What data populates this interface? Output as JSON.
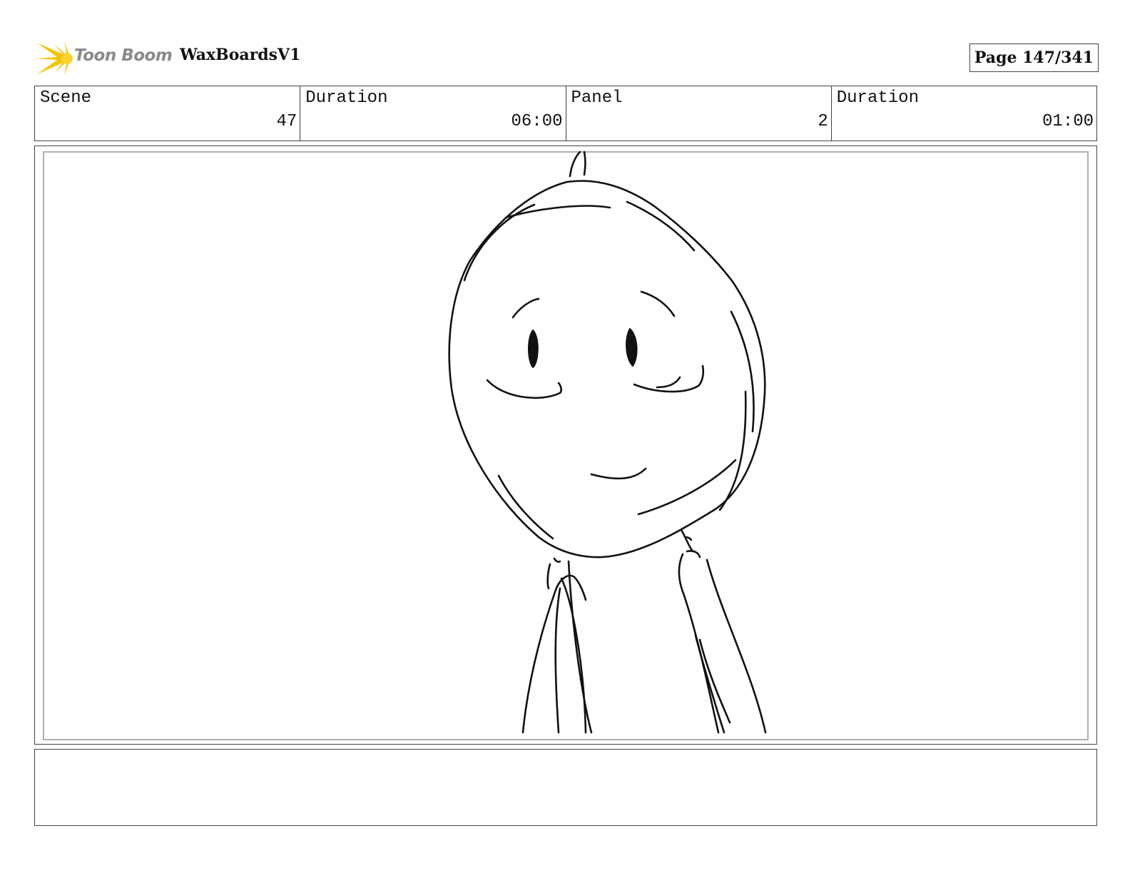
{
  "header": {
    "logo_text": "Toon Boom",
    "project_title": "WaxBoardsV1",
    "page_label": "Page 147/341"
  },
  "info": {
    "scene_label": "Scene",
    "scene_value": "47",
    "scene_duration_label": "Duration",
    "scene_duration_value": "06:00",
    "panel_label": "Panel",
    "panel_value": "2",
    "panel_duration_label": "Duration",
    "panel_duration_value": "01:00"
  },
  "colors": {
    "logo_yellow": "#f5c400",
    "logo_text": "#8a8a8a",
    "border": "#444444",
    "ink": "#111111"
  },
  "notes": {
    "text": ""
  }
}
